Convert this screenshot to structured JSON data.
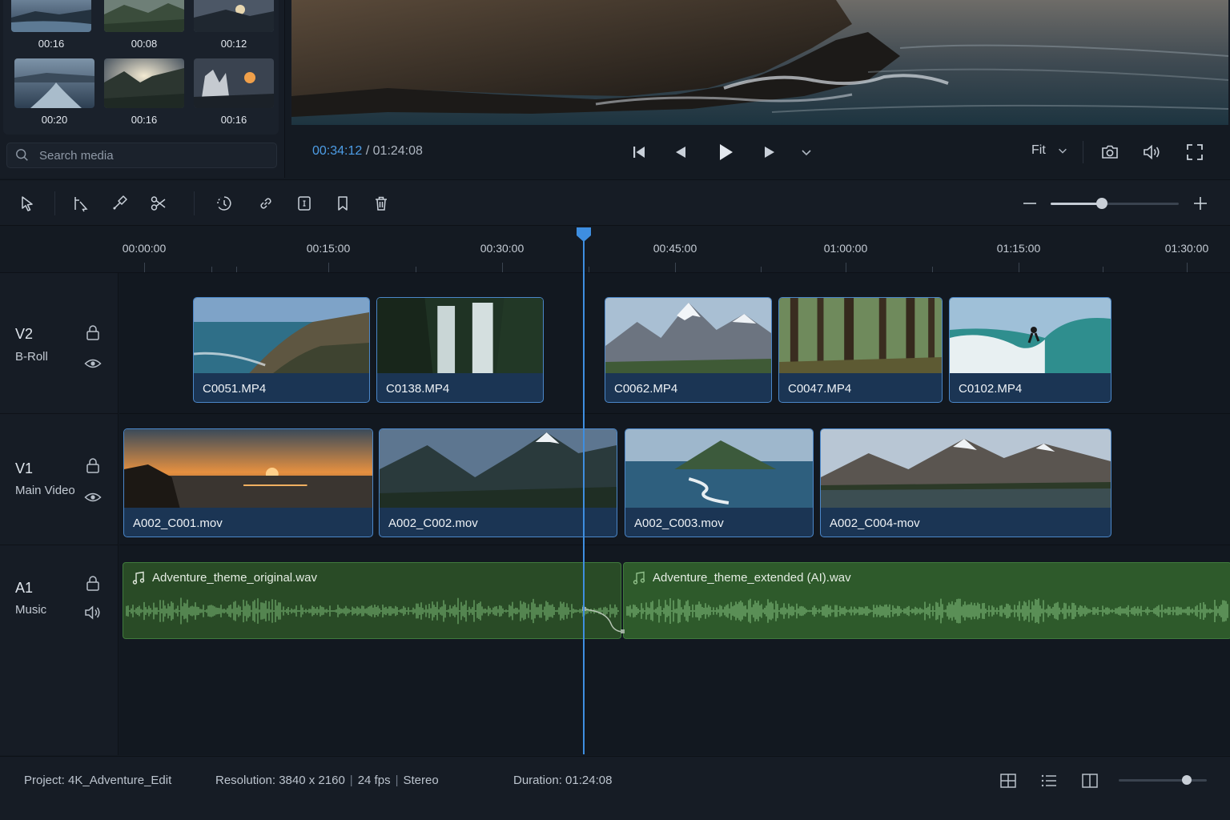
{
  "media": {
    "thumbnails": [
      {
        "duration": "00:16",
        "scene": "lake"
      },
      {
        "duration": "00:08",
        "scene": "valley"
      },
      {
        "duration": "00:12",
        "scene": "coast-sunset"
      },
      {
        "duration": "00:20",
        "scene": "river"
      },
      {
        "duration": "00:16",
        "scene": "mountain-sun"
      },
      {
        "duration": "00:16",
        "scene": "rocks-sunset"
      }
    ],
    "search_placeholder": "Search media"
  },
  "viewer": {
    "current_time": "00:34:12",
    "separator": "/",
    "total_time": "01:24:08",
    "fit_label": "Fit"
  },
  "timeline": {
    "ruler_labels": [
      "00:00:00",
      "00:15:00",
      "00:30:00",
      "00:45:00",
      "01:00:00",
      "01:15:00",
      "01:30:00"
    ],
    "tracks": [
      {
        "id": "V2",
        "name": "B-Roll"
      },
      {
        "id": "V1",
        "name": "Main Video"
      },
      {
        "id": "A1",
        "name": "Music"
      }
    ],
    "v2_clips": [
      {
        "name": "C0051.MP4",
        "scene": "coast"
      },
      {
        "name": "C0138.MP4",
        "scene": "waterfall"
      },
      {
        "name": "C0062.MP4",
        "scene": "snow-mountains"
      },
      {
        "name": "C0047.MP4",
        "scene": "forest"
      },
      {
        "name": "C0102.MP4",
        "scene": "surf"
      }
    ],
    "v1_clips": [
      {
        "name": "A002_C001.mov",
        "scene": "sunset-sea"
      },
      {
        "name": "A002_C002.mov",
        "scene": "mountain-valley"
      },
      {
        "name": "A002_C003.mov",
        "scene": "island"
      },
      {
        "name": "A002_C004-mov",
        "scene": "alpine-lake"
      }
    ],
    "audio_clips": [
      {
        "name": "Adventure_theme_original.wav"
      },
      {
        "name": "Adventure_theme_extended (AI).wav"
      }
    ],
    "zoom_level": 0.4
  },
  "status": {
    "project": "Project: 4K_Adventure_Edit",
    "resolution": "Resolution: 3840 x 2160",
    "fps": "24 fps",
    "audio": "Stereo",
    "divider": "|",
    "duration": "Duration: 01:24:08",
    "zoom_level": 0.77
  },
  "colors": {
    "accent": "#3e8ee0",
    "clip_border": "#4b87c9",
    "audio_clip": "#294b26",
    "waveform": "#7fbf79"
  }
}
